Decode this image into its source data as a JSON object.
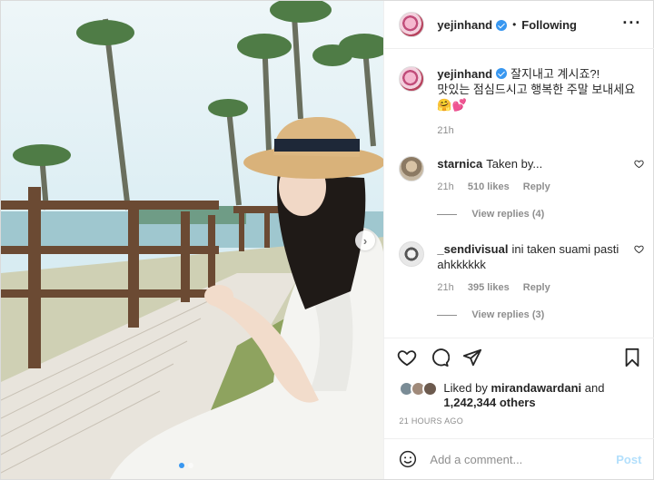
{
  "post": {
    "author": "yejinhand",
    "follow_status": "Following",
    "more_icon": "more-horizontal-icon",
    "caption_line1": "잘지내고 계시죠?!",
    "caption_line2": "맛있는 점심드시고 행복한 주말 보내세요",
    "caption_emoji": "🤗💕",
    "caption_time": "21h",
    "comments": [
      {
        "username": "starnica",
        "text": "Taken by...",
        "time": "21h",
        "likes": "510 likes",
        "reply": "Reply",
        "view_replies": "View replies (4)"
      },
      {
        "username": "_sendivisual",
        "text": "ini taken suami pasti ahkkkkkk",
        "time": "21h",
        "likes": "395 likes",
        "reply": "Reply",
        "view_replies": "View replies (3)"
      }
    ],
    "liked_by_prefix": "Liked by",
    "liked_by_user": "mirandawardani",
    "liked_by_and": "and",
    "liked_by_count": "1,242,344 others",
    "timestamp": "21 HOURS AGO",
    "add_comment_placeholder": "Add a comment...",
    "post_button": "Post",
    "carousel_dots": 2,
    "carousel_active": 1
  },
  "colors": {
    "verified": "#3897f0",
    "muted": "#8e8e8e",
    "post_button": "#b2dffc"
  }
}
